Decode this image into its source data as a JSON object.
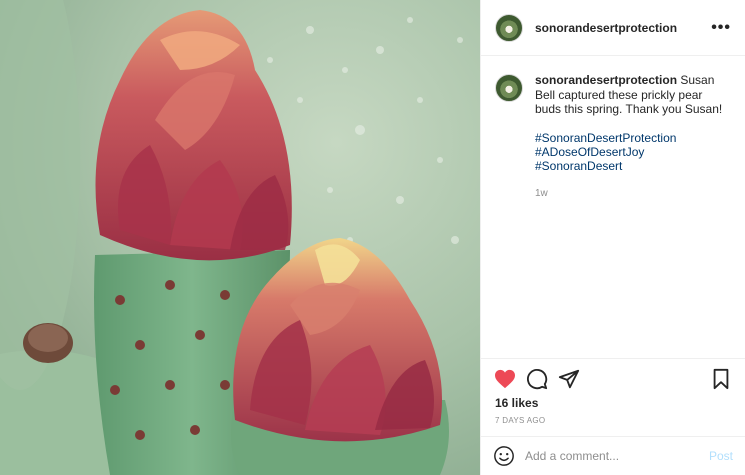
{
  "post": {
    "photo_alt": "prickly pear buds",
    "icon": "prickly-pear-photo"
  },
  "header": {
    "username": "sonorandesertprotection",
    "more_icon": "ellipsis-icon",
    "more_label": "•••"
  },
  "caption": {
    "username": "sonorandesertprotection",
    "text": " Susan Bell captured these prickly pear buds this spring. Thank you Susan!",
    "hashtags": [
      "#SonoranDesertProtection",
      "#ADoseOfDesertJoy",
      "#SonoranDesert"
    ],
    "time_ago": "1w"
  },
  "actions": {
    "like_icon": "heart-filled-icon",
    "comment_icon": "comment-icon",
    "share_icon": "paper-plane-icon",
    "save_icon": "bookmark-icon",
    "like_color": "#ed4956"
  },
  "likes": "16 likes",
  "date": "7 DAYS AGO",
  "comment_bar": {
    "emoji_icon": "smiley-icon",
    "placeholder": "Add a comment...",
    "post_label": "Post",
    "post_color": "#b2dffc"
  }
}
